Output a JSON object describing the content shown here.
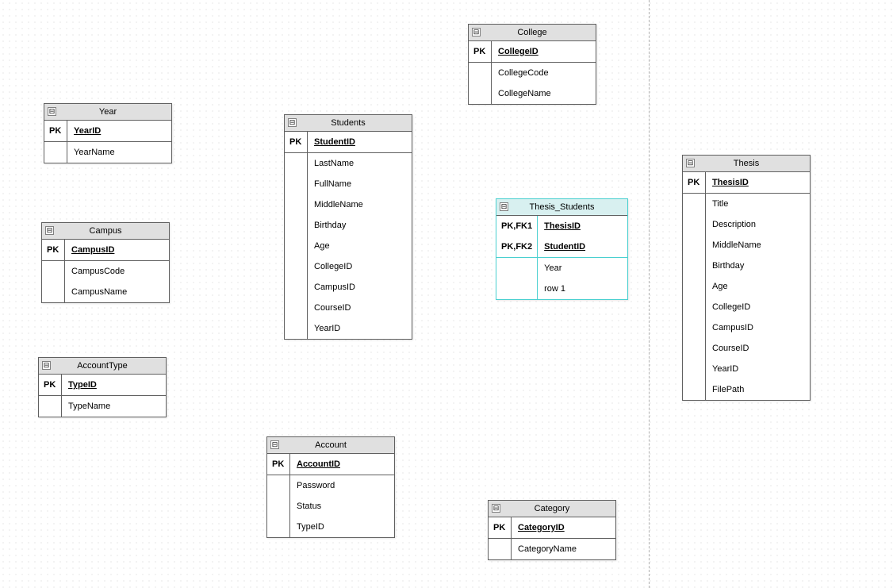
{
  "entities": {
    "year": {
      "title": "Year",
      "pk_label": "PK",
      "pk_attr": "YearID",
      "attrs": [
        "YearName"
      ]
    },
    "campus": {
      "title": "Campus",
      "pk_label": "PK",
      "pk_attr": "CampusID",
      "attrs": [
        "CampusCode",
        "CampusName"
      ]
    },
    "accounttype": {
      "title": "AccountType",
      "pk_label": "PK",
      "pk_attr": "TypeID",
      "attrs": [
        "TypeName"
      ]
    },
    "students": {
      "title": "Students",
      "pk_label": "PK",
      "pk_attr": "StudentID",
      "attrs": [
        "LastName",
        "FullName",
        "MiddleName",
        "Birthday",
        "Age",
        "CollegeID",
        "CampusID",
        "CourseID",
        "YearID"
      ]
    },
    "account": {
      "title": "Account",
      "pk_label": "PK",
      "pk_attr": "AccountID",
      "attrs": [
        "Password",
        "Status",
        "TypeID"
      ]
    },
    "college": {
      "title": "College",
      "pk_label": "PK",
      "pk_attr": "CollegeID",
      "attrs": [
        "CollegeCode",
        "CollegeName"
      ]
    },
    "thesis_students": {
      "title": "Thesis_Students",
      "pk1_label": "PK,FK1",
      "pk1_attr": "ThesisID",
      "pk2_label": "PK,FK2",
      "pk2_attr": "StudentID",
      "attrs": [
        "Year",
        "row 1"
      ]
    },
    "category": {
      "title": "Category",
      "pk_label": "PK",
      "pk_attr": "CategoryID",
      "attrs": [
        "CategoryName"
      ]
    },
    "thesis": {
      "title": "Thesis",
      "pk_label": "PK",
      "pk_attr": "ThesisID",
      "attrs": [
        "Title",
        "Description",
        "MiddleName",
        "Birthday",
        "Age",
        "CollegeID",
        "CampusID",
        "CourseID",
        "YearID",
        "FilePath"
      ]
    }
  },
  "collapse_glyph": "⊟"
}
